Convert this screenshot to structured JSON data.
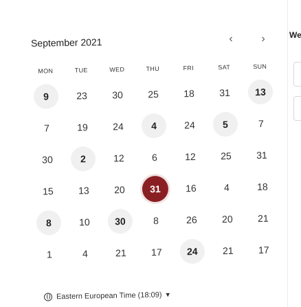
{
  "calendar": {
    "month_label": "September 2021",
    "prev_icon": "chevron-left-icon",
    "next_icon": "chevron-right-icon",
    "prev_glyph": "‹",
    "next_glyph": "›",
    "weekdays": [
      "MON",
      "TUE",
      "WED",
      "THU",
      "FRI",
      "SAT",
      "SUN"
    ],
    "weeks": [
      [
        {
          "d": "9",
          "s": "avail"
        },
        {
          "d": "23",
          "s": "none"
        },
        {
          "d": "30",
          "s": "none"
        },
        {
          "d": "25",
          "s": "none"
        },
        {
          "d": "18",
          "s": "none"
        },
        {
          "d": "31",
          "s": "none"
        },
        {
          "d": "13",
          "s": "avail"
        }
      ],
      [
        {
          "d": "7",
          "s": "none"
        },
        {
          "d": "19",
          "s": "none"
        },
        {
          "d": "24",
          "s": "none"
        },
        {
          "d": "4",
          "s": "avail"
        },
        {
          "d": "24",
          "s": "none"
        },
        {
          "d": "5",
          "s": "avail"
        },
        {
          "d": "7",
          "s": "none"
        }
      ],
      [
        {
          "d": "30",
          "s": "none"
        },
        {
          "d": "2",
          "s": "avail"
        },
        {
          "d": "12",
          "s": "none"
        },
        {
          "d": "6",
          "s": "none"
        },
        {
          "d": "12",
          "s": "none"
        },
        {
          "d": "25",
          "s": "none"
        },
        {
          "d": "31",
          "s": "none"
        }
      ],
      [
        {
          "d": "15",
          "s": "none"
        },
        {
          "d": "13",
          "s": "none"
        },
        {
          "d": "20",
          "s": "none"
        },
        {
          "d": "31",
          "s": "selected"
        },
        {
          "d": "16",
          "s": "none"
        },
        {
          "d": "4",
          "s": "none"
        },
        {
          "d": "18",
          "s": "none"
        }
      ],
      [
        {
          "d": "8",
          "s": "avail"
        },
        {
          "d": "10",
          "s": "none"
        },
        {
          "d": "30",
          "s": "avail"
        },
        {
          "d": "8",
          "s": "none"
        },
        {
          "d": "26",
          "s": "none"
        },
        {
          "d": "20",
          "s": "none"
        },
        {
          "d": "21",
          "s": "none"
        }
      ],
      [
        {
          "d": "1",
          "s": "none"
        },
        {
          "d": "4",
          "s": "none"
        },
        {
          "d": "21",
          "s": "none"
        },
        {
          "d": "17",
          "s": "none"
        },
        {
          "d": "24",
          "s": "avail"
        },
        {
          "d": "21",
          "s": "none"
        },
        {
          "d": "17",
          "s": "none"
        }
      ]
    ],
    "selected_color": "#8a1f23",
    "available_color": "#f0f0f0"
  },
  "timezone": {
    "icon": "globe-icon",
    "label": "Eastern European Time (18:09)",
    "caret_icon": "caret-down-icon",
    "caret": "▾"
  },
  "side_panel": {
    "label": "We"
  }
}
